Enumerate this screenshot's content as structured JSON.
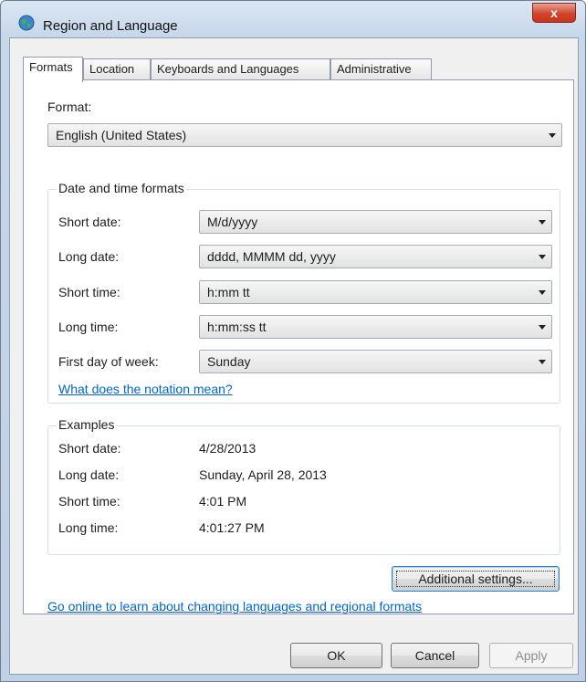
{
  "window": {
    "title": "Region and Language",
    "close_glyph": "x"
  },
  "tabs": [
    {
      "label": "Formats",
      "active": true
    },
    {
      "label": "Location",
      "active": false
    },
    {
      "label": "Keyboards and Languages",
      "active": false
    },
    {
      "label": "Administrative",
      "active": false
    }
  ],
  "format": {
    "label": "Format:",
    "value": "English (United States)"
  },
  "date_time_formats": {
    "title": "Date and time formats",
    "rows": [
      {
        "label": "Short date:",
        "value": "M/d/yyyy"
      },
      {
        "label": "Long date:",
        "value": "dddd, MMMM dd, yyyy"
      },
      {
        "label": "Short time:",
        "value": "h:mm tt"
      },
      {
        "label": "Long time:",
        "value": "h:mm:ss tt"
      },
      {
        "label": "First day of week:",
        "value": "Sunday"
      }
    ],
    "notation_link": "What does the notation mean?"
  },
  "examples": {
    "title": "Examples",
    "rows": [
      {
        "label": "Short date:",
        "value": "4/28/2013"
      },
      {
        "label": "Long date:",
        "value": "Sunday, April 28, 2013"
      },
      {
        "label": "Short time:",
        "value": "4:01 PM"
      },
      {
        "label": "Long time:",
        "value": "4:01:27 PM"
      }
    ]
  },
  "additional_settings_label": "Additional settings...",
  "online_link": "Go online to learn about changing languages and regional formats",
  "buttons": {
    "ok": "OK",
    "cancel": "Cancel",
    "apply": "Apply"
  },
  "colors": {
    "link": "#0066cc",
    "close_button": "#c7351d",
    "title_bar": "#c6d7ea"
  }
}
